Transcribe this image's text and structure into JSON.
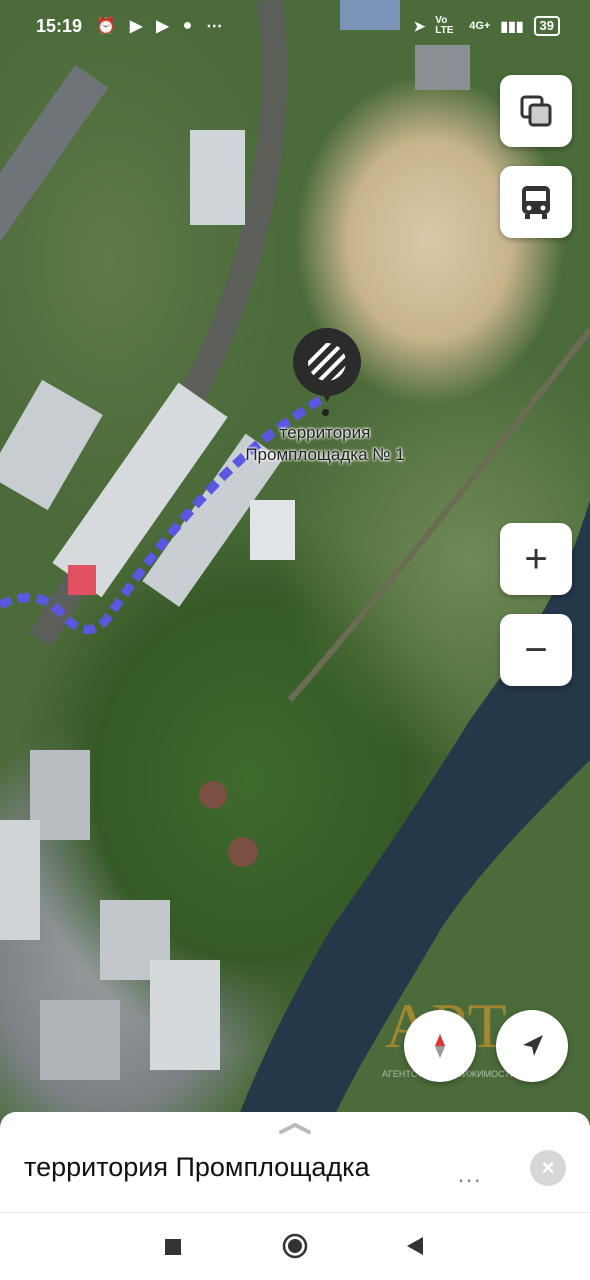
{
  "status_bar": {
    "time": "15:19",
    "icons": [
      "alarm-icon",
      "play-icon",
      "play-icon",
      "message-icon",
      "more-icon"
    ],
    "network_label": "4G+",
    "volte_label": "Vo LTE",
    "battery": "39"
  },
  "map": {
    "pin_icon": "striped-circle-icon",
    "place_label_line1": "территория",
    "place_label_line2": "Промплощадка № 1",
    "route_color": "#5a57e0",
    "watermark_text": "АРТ",
    "watermark_sub": "АГЕНТСТВО НЕДВИЖИМОСТИ",
    "controls": {
      "layers_icon": "layers-icon",
      "transport_icon": "bus-icon",
      "zoom_in": "+",
      "zoom_out": "−",
      "compass_icon": "compass-icon",
      "location_icon": "navigation-arrow-icon"
    }
  },
  "sheet": {
    "title": "территория Промплощадка",
    "more": "...",
    "close": "×"
  },
  "nav": {
    "recent_icon": "square-icon",
    "home_icon": "circle-icon",
    "back_icon": "triangle-back-icon"
  }
}
